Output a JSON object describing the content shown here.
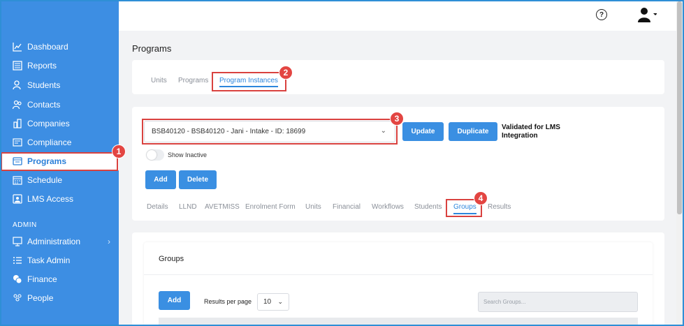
{
  "sidebar": {
    "items": [
      {
        "label": "Dashboard",
        "icon": "chart-line-icon"
      },
      {
        "label": "Reports",
        "icon": "report-icon"
      },
      {
        "label": "Students",
        "icon": "students-icon"
      },
      {
        "label": "Contacts",
        "icon": "contacts-icon"
      },
      {
        "label": "Companies",
        "icon": "companies-icon"
      },
      {
        "label": "Compliance",
        "icon": "compliance-icon"
      },
      {
        "label": "Programs",
        "icon": "programs-icon"
      },
      {
        "label": "Schedule",
        "icon": "calendar-icon"
      },
      {
        "label": "LMS Access",
        "icon": "lms-icon"
      }
    ],
    "admin_label": "ADMIN",
    "admin_items": [
      {
        "label": "Administration",
        "icon": "monitor-icon"
      },
      {
        "label": "Task Admin",
        "icon": "list-icon"
      },
      {
        "label": "Finance",
        "icon": "coins-icon"
      },
      {
        "label": "People",
        "icon": "people-icon"
      }
    ],
    "active_label": "Programs"
  },
  "page": {
    "title": "Programs"
  },
  "top_tabs": [
    "Units",
    "Programs",
    "Program Instances"
  ],
  "program": {
    "selected": "BSB40120 - BSB40120 - Jani - Intake - ID: 18699",
    "update_label": "Update",
    "duplicate_label": "Duplicate",
    "lms_status": "Validated for LMS Integration",
    "show_inactive_label": "Show Inactive",
    "add_label": "Add",
    "delete_label": "Delete"
  },
  "sub_tabs": [
    "Details",
    "LLND",
    "AVETMISS",
    "Enrolment Form",
    "Units",
    "Financial",
    "Workflows",
    "Students",
    "Groups",
    "Results"
  ],
  "groups": {
    "title": "Groups",
    "add_label": "Add",
    "results_per_page_label": "Results per page",
    "results_per_page_value": "10",
    "search_placeholder": "Search Groups..."
  },
  "annotations": [
    "1",
    "2",
    "3",
    "4"
  ],
  "colors": {
    "sidebar": "#3d8ee3",
    "accent": "#2d86dc",
    "highlight": "#d9423f"
  }
}
